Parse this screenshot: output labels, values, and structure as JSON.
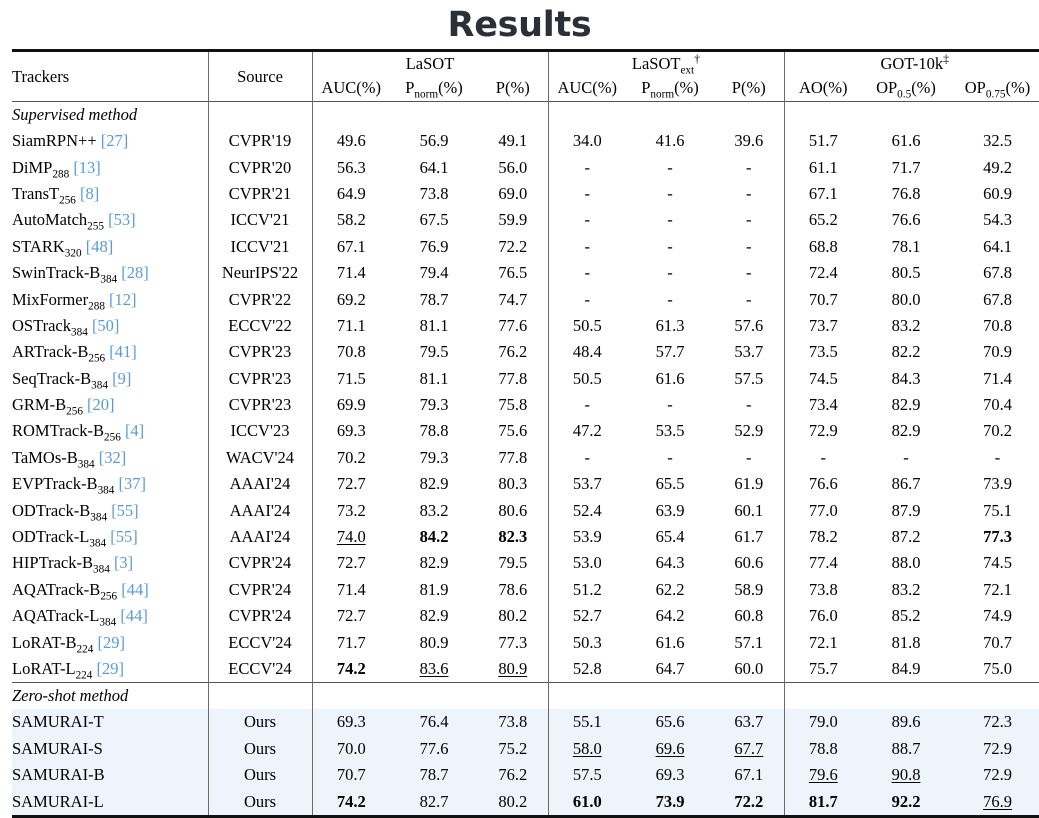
{
  "title": "Results",
  "table": {
    "header": {
      "trackers": "Trackers",
      "source": "Source",
      "groups": [
        {
          "name": "LaSOT",
          "marker": ""
        },
        {
          "name": "LaSOT",
          "sub": "ext",
          "marker": "†"
        },
        {
          "name": "GOT-10k",
          "marker": "‡"
        }
      ],
      "subcols": [
        {
          "label": "AUC(%)"
        },
        {
          "label": "P",
          "sub": "norm",
          "suffix": "(%)"
        },
        {
          "label": "P(%)"
        },
        {
          "label": "AUC(%)"
        },
        {
          "label": "P",
          "sub": "norm",
          "suffix": "(%)"
        },
        {
          "label": "P(%)"
        },
        {
          "label": "AO(%)"
        },
        {
          "label": "OP",
          "sub": "0.5",
          "suffix": "(%)"
        },
        {
          "label": "OP",
          "sub": "0.75",
          "suffix": "(%)"
        }
      ]
    },
    "sections": [
      {
        "label": "Supervised method",
        "highlight": false,
        "rows": [
          {
            "name": "SiamRPN++",
            "sub": "",
            "cite": "27",
            "source": "CVPR'19",
            "values": [
              "49.6",
              "56.9",
              "49.1",
              "34.0",
              "41.6",
              "39.6",
              "51.7",
              "61.6",
              "32.5"
            ],
            "styles": [
              "",
              "",
              "",
              "",
              "",
              "",
              "",
              "",
              ""
            ]
          },
          {
            "name": "DiMP",
            "sub": "288",
            "cite": "13",
            "source": "CVPR'20",
            "values": [
              "56.3",
              "64.1",
              "56.0",
              "-",
              "-",
              "-",
              "61.1",
              "71.7",
              "49.2"
            ],
            "styles": [
              "",
              "",
              "",
              "",
              "",
              "",
              "",
              "",
              ""
            ]
          },
          {
            "name": "TransT",
            "sub": "256",
            "cite": "8",
            "source": "CVPR'21",
            "values": [
              "64.9",
              "73.8",
              "69.0",
              "-",
              "-",
              "-",
              "67.1",
              "76.8",
              "60.9"
            ],
            "styles": [
              "",
              "",
              "",
              "",
              "",
              "",
              "",
              "",
              ""
            ]
          },
          {
            "name": "AutoMatch",
            "sub": "255",
            "cite": "53",
            "source": "ICCV'21",
            "values": [
              "58.2",
              "67.5",
              "59.9",
              "-",
              "-",
              "-",
              "65.2",
              "76.6",
              "54.3"
            ],
            "styles": [
              "",
              "",
              "",
              "",
              "",
              "",
              "",
              "",
              ""
            ]
          },
          {
            "name": "STARK",
            "sub": "320",
            "cite": "48",
            "source": "ICCV'21",
            "values": [
              "67.1",
              "76.9",
              "72.2",
              "-",
              "-",
              "-",
              "68.8",
              "78.1",
              "64.1"
            ],
            "styles": [
              "",
              "",
              "",
              "",
              "",
              "",
              "",
              "",
              ""
            ]
          },
          {
            "name": "SwinTrack-B",
            "sub": "384",
            "cite": "28",
            "source": "NeurIPS'22",
            "values": [
              "71.4",
              "79.4",
              "76.5",
              "-",
              "-",
              "-",
              "72.4",
              "80.5",
              "67.8"
            ],
            "styles": [
              "",
              "",
              "",
              "",
              "",
              "",
              "",
              "",
              ""
            ]
          },
          {
            "name": "MixFormer",
            "sub": "288",
            "cite": "12",
            "source": "CVPR'22",
            "values": [
              "69.2",
              "78.7",
              "74.7",
              "-",
              "-",
              "-",
              "70.7",
              "80.0",
              "67.8"
            ],
            "styles": [
              "",
              "",
              "",
              "",
              "",
              "",
              "",
              "",
              ""
            ]
          },
          {
            "name": "OSTrack",
            "sub": "384",
            "cite": "50",
            "source": "ECCV'22",
            "values": [
              "71.1",
              "81.1",
              "77.6",
              "50.5",
              "61.3",
              "57.6",
              "73.7",
              "83.2",
              "70.8"
            ],
            "styles": [
              "",
              "",
              "",
              "",
              "",
              "",
              "",
              "",
              ""
            ]
          },
          {
            "name": "ARTrack-B",
            "sub": "256",
            "cite": "41",
            "source": "CVPR'23",
            "values": [
              "70.8",
              "79.5",
              "76.2",
              "48.4",
              "57.7",
              "53.7",
              "73.5",
              "82.2",
              "70.9"
            ],
            "styles": [
              "",
              "",
              "",
              "",
              "",
              "",
              "",
              "",
              ""
            ]
          },
          {
            "name": "SeqTrack-B",
            "sub": "384",
            "cite": "9",
            "source": "CVPR'23",
            "values": [
              "71.5",
              "81.1",
              "77.8",
              "50.5",
              "61.6",
              "57.5",
              "74.5",
              "84.3",
              "71.4"
            ],
            "styles": [
              "",
              "",
              "",
              "",
              "",
              "",
              "",
              "",
              ""
            ]
          },
          {
            "name": "GRM-B",
            "sub": "256",
            "cite": "20",
            "source": "CVPR'23",
            "values": [
              "69.9",
              "79.3",
              "75.8",
              "-",
              "-",
              "-",
              "73.4",
              "82.9",
              "70.4"
            ],
            "styles": [
              "",
              "",
              "",
              "",
              "",
              "",
              "",
              "",
              ""
            ]
          },
          {
            "name": "ROMTrack-B",
            "sub": "256",
            "cite": "4",
            "source": "ICCV'23",
            "values": [
              "69.3",
              "78.8",
              "75.6",
              "47.2",
              "53.5",
              "52.9",
              "72.9",
              "82.9",
              "70.2"
            ],
            "styles": [
              "",
              "",
              "",
              "",
              "",
              "",
              "",
              "",
              ""
            ]
          },
          {
            "name": "TaMOs-B",
            "sub": "384",
            "cite": "32",
            "source": "WACV'24",
            "values": [
              "70.2",
              "79.3",
              "77.8",
              "-",
              "-",
              "-",
              "-",
              "-",
              "-"
            ],
            "styles": [
              "",
              "",
              "",
              "",
              "",
              "",
              "",
              "",
              ""
            ]
          },
          {
            "name": "EVPTrack-B",
            "sub": "384",
            "cite": "37",
            "source": "AAAI'24",
            "values": [
              "72.7",
              "82.9",
              "80.3",
              "53.7",
              "65.5",
              "61.9",
              "76.6",
              "86.7",
              "73.9"
            ],
            "styles": [
              "",
              "",
              "",
              "",
              "",
              "",
              "",
              "",
              ""
            ]
          },
          {
            "name": "ODTrack-B",
            "sub": "384",
            "cite": "55",
            "source": "AAAI'24",
            "values": [
              "73.2",
              "83.2",
              "80.6",
              "52.4",
              "63.9",
              "60.1",
              "77.0",
              "87.9",
              "75.1"
            ],
            "styles": [
              "",
              "",
              "",
              "",
              "",
              "",
              "",
              "",
              ""
            ]
          },
          {
            "name": "ODTrack-L",
            "sub": "384",
            "cite": "55",
            "source": "AAAI'24",
            "values": [
              "74.0",
              "84.2",
              "82.3",
              "53.9",
              "65.4",
              "61.7",
              "78.2",
              "87.2",
              "77.3"
            ],
            "styles": [
              "u",
              "b",
              "b",
              "",
              "",
              "",
              "",
              "",
              "b"
            ]
          },
          {
            "name": "HIPTrack-B",
            "sub": "384",
            "cite": "3",
            "source": "CVPR'24",
            "values": [
              "72.7",
              "82.9",
              "79.5",
              "53.0",
              "64.3",
              "60.6",
              "77.4",
              "88.0",
              "74.5"
            ],
            "styles": [
              "",
              "",
              "",
              "",
              "",
              "",
              "",
              "",
              ""
            ]
          },
          {
            "name": "AQATrack-B",
            "sub": "256",
            "cite": "44",
            "source": "CVPR'24",
            "values": [
              "71.4",
              "81.9",
              "78.6",
              "51.2",
              "62.2",
              "58.9",
              "73.8",
              "83.2",
              "72.1"
            ],
            "styles": [
              "",
              "",
              "",
              "",
              "",
              "",
              "",
              "",
              ""
            ]
          },
          {
            "name": "AQATrack-L",
            "sub": "384",
            "cite": "44",
            "source": "CVPR'24",
            "values": [
              "72.7",
              "82.9",
              "80.2",
              "52.7",
              "64.2",
              "60.8",
              "76.0",
              "85.2",
              "74.9"
            ],
            "styles": [
              "",
              "",
              "",
              "",
              "",
              "",
              "",
              "",
              ""
            ]
          },
          {
            "name": "LoRAT-B",
            "sub": "224",
            "cite": "29",
            "source": "ECCV'24",
            "values": [
              "71.7",
              "80.9",
              "77.3",
              "50.3",
              "61.6",
              "57.1",
              "72.1",
              "81.8",
              "70.7"
            ],
            "styles": [
              "",
              "",
              "",
              "",
              "",
              "",
              "",
              "",
              ""
            ]
          },
          {
            "name": "LoRAT-L",
            "sub": "224",
            "cite": "29",
            "source": "ECCV'24",
            "values": [
              "74.2",
              "83.6",
              "80.9",
              "52.8",
              "64.7",
              "60.0",
              "75.7",
              "84.9",
              "75.0"
            ],
            "styles": [
              "b",
              "u",
              "u",
              "",
              "",
              "",
              "",
              "",
              ""
            ]
          }
        ]
      },
      {
        "label": "Zero-shot method",
        "highlight": true,
        "rows": [
          {
            "name": "SAMURAI-T",
            "sub": "",
            "cite": "",
            "source": "Ours",
            "values": [
              "69.3",
              "76.4",
              "73.8",
              "55.1",
              "65.6",
              "63.7",
              "79.0",
              "89.6",
              "72.3"
            ],
            "styles": [
              "",
              "",
              "",
              "",
              "",
              "",
              "",
              "",
              ""
            ]
          },
          {
            "name": "SAMURAI-S",
            "sub": "",
            "cite": "",
            "source": "Ours",
            "values": [
              "70.0",
              "77.6",
              "75.2",
              "58.0",
              "69.6",
              "67.7",
              "78.8",
              "88.7",
              "72.9"
            ],
            "styles": [
              "",
              "",
              "",
              "u",
              "u",
              "u",
              "",
              "",
              ""
            ]
          },
          {
            "name": "SAMURAI-B",
            "sub": "",
            "cite": "",
            "source": "Ours",
            "values": [
              "70.7",
              "78.7",
              "76.2",
              "57.5",
              "69.3",
              "67.1",
              "79.6",
              "90.8",
              "72.9"
            ],
            "styles": [
              "",
              "",
              "",
              "",
              "",
              "",
              "u",
              "u",
              ""
            ]
          },
          {
            "name": "SAMURAI-L",
            "sub": "",
            "cite": "",
            "source": "Ours",
            "values": [
              "74.2",
              "82.7",
              "80.2",
              "61.0",
              "73.9",
              "72.2",
              "81.7",
              "92.2",
              "76.9"
            ],
            "styles": [
              "b",
              "",
              "",
              "b",
              "b",
              "b",
              "b",
              "b",
              "u"
            ]
          }
        ]
      }
    ]
  },
  "colors": {
    "citation": "#5b9bd5",
    "highlight_row": "#eef4fb",
    "title": "#2b3038",
    "rule": "#111111"
  }
}
